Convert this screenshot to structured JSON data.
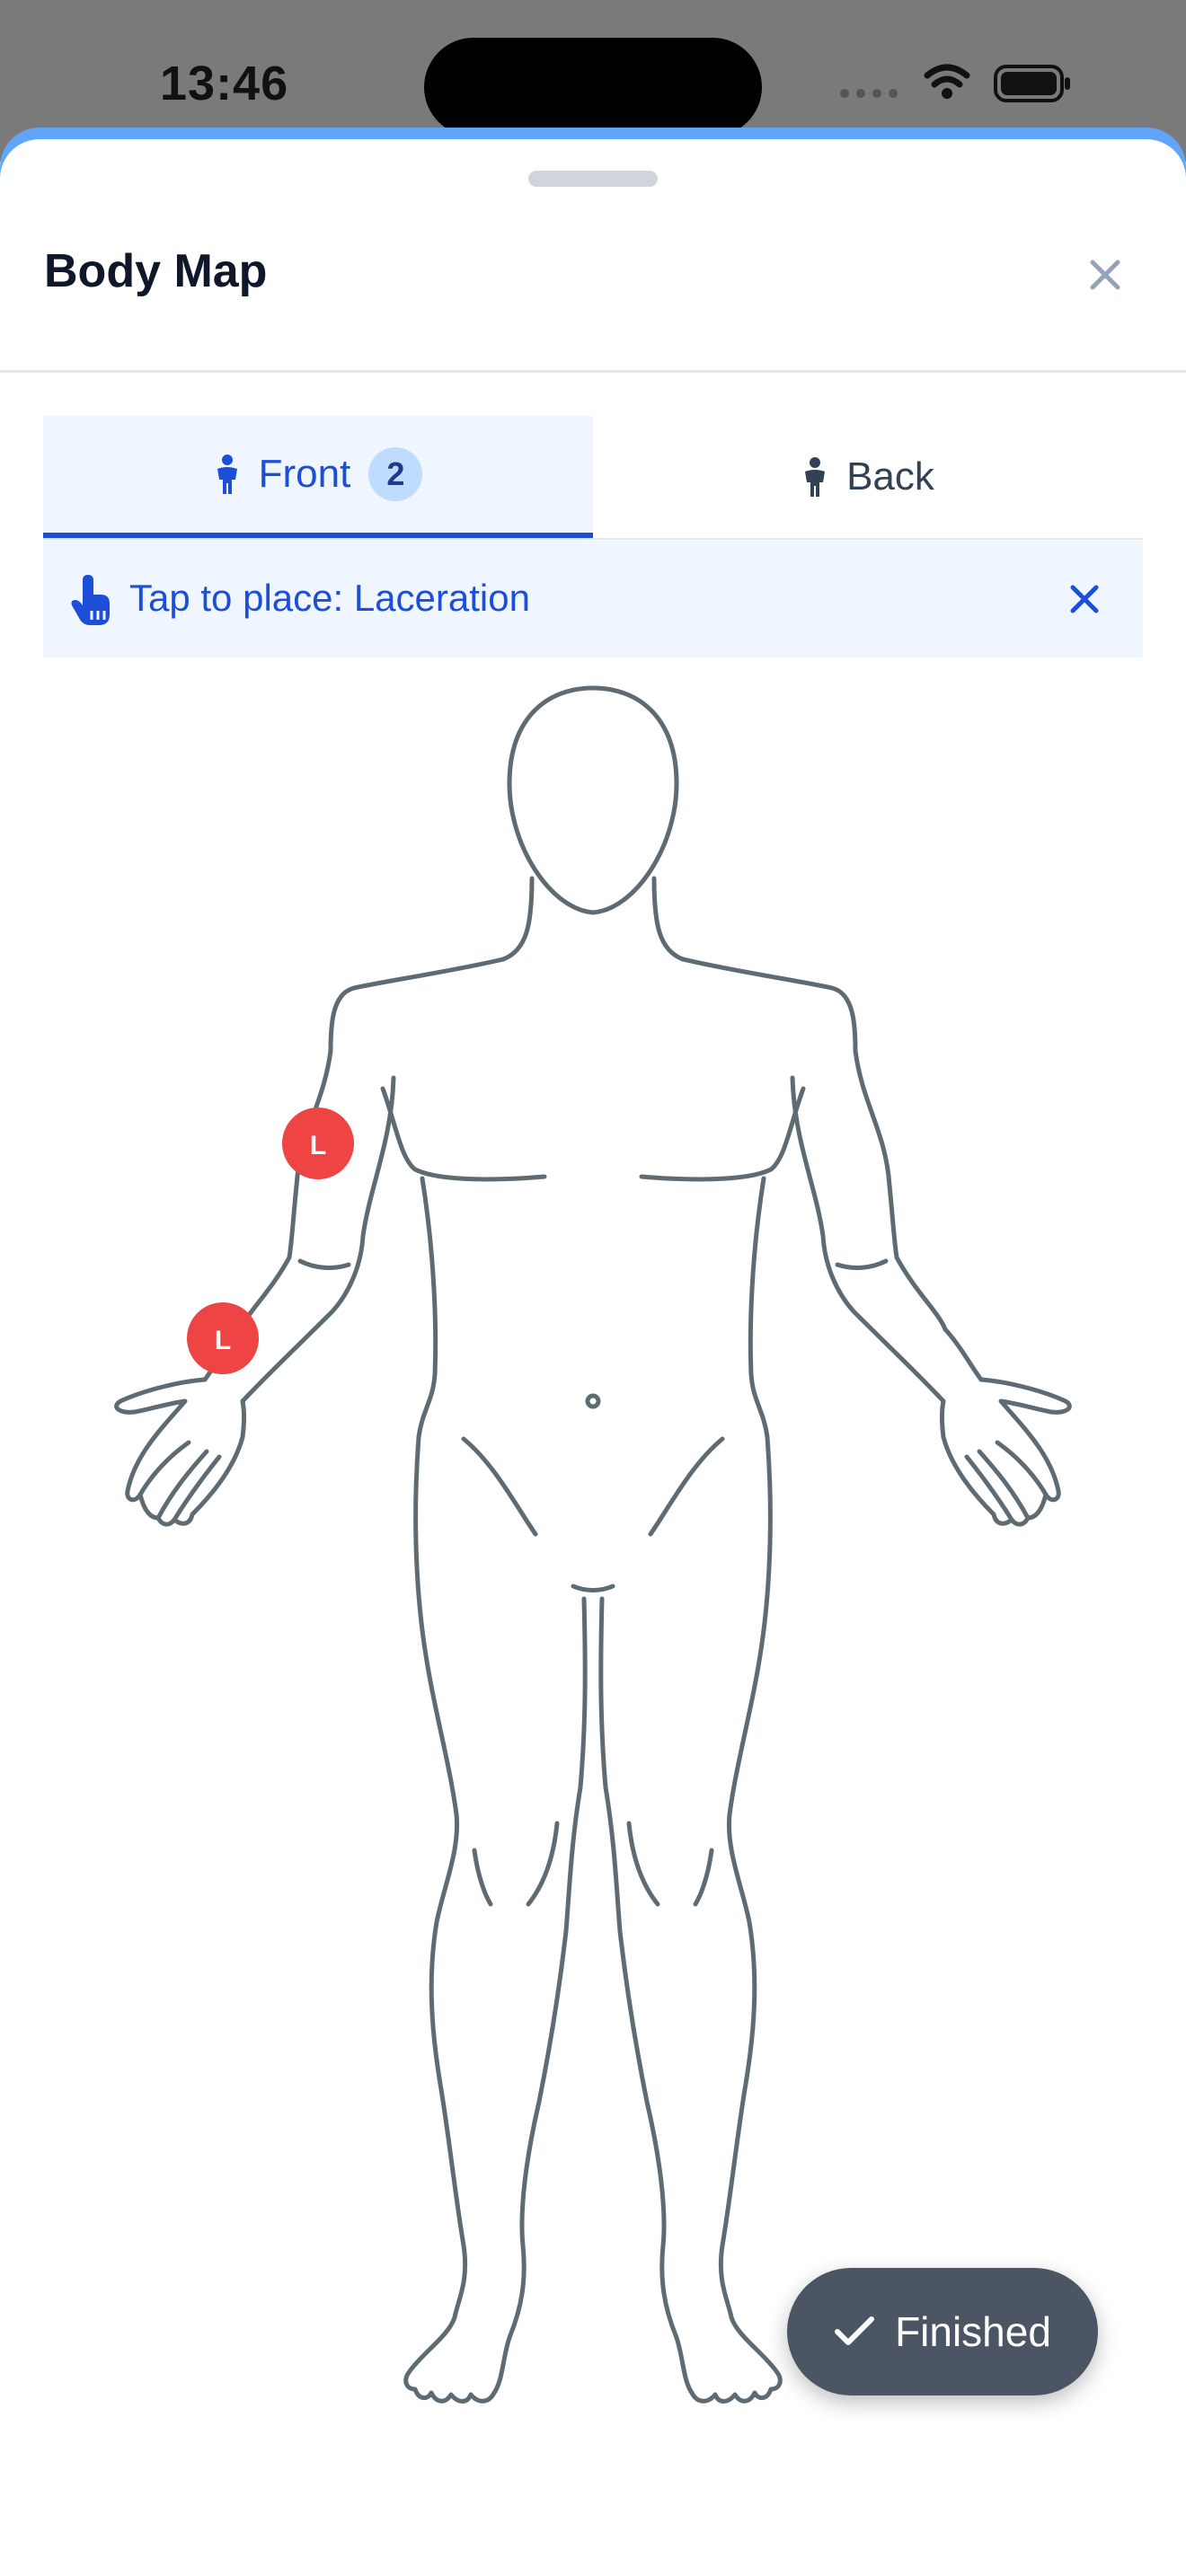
{
  "status_bar": {
    "time": "13:46"
  },
  "sheet": {
    "title": "Body Map",
    "close_icon": "close-icon"
  },
  "tabs": [
    {
      "label": "Front",
      "badge": "2",
      "icon": "person-standing-icon",
      "selected": true
    },
    {
      "label": "Back",
      "icon": "person-standing-icon",
      "selected": false
    }
  ],
  "tap_banner": {
    "text": "Tap to place: Laceration",
    "icon": "hand-pointer-icon",
    "close_icon": "close-icon"
  },
  "markers": [
    {
      "label": "L",
      "region": "left-upper-arm"
    },
    {
      "label": "L",
      "region": "left-forearm"
    }
  ],
  "finished_button": {
    "label": "Finished",
    "icon": "checkmark-icon"
  },
  "colors": {
    "accent": "#1d4ed8",
    "banner_bg": "#eff6ff",
    "marker": "#ef4444",
    "outline": "#5f6b73",
    "finished_bg": "#4b5563"
  }
}
